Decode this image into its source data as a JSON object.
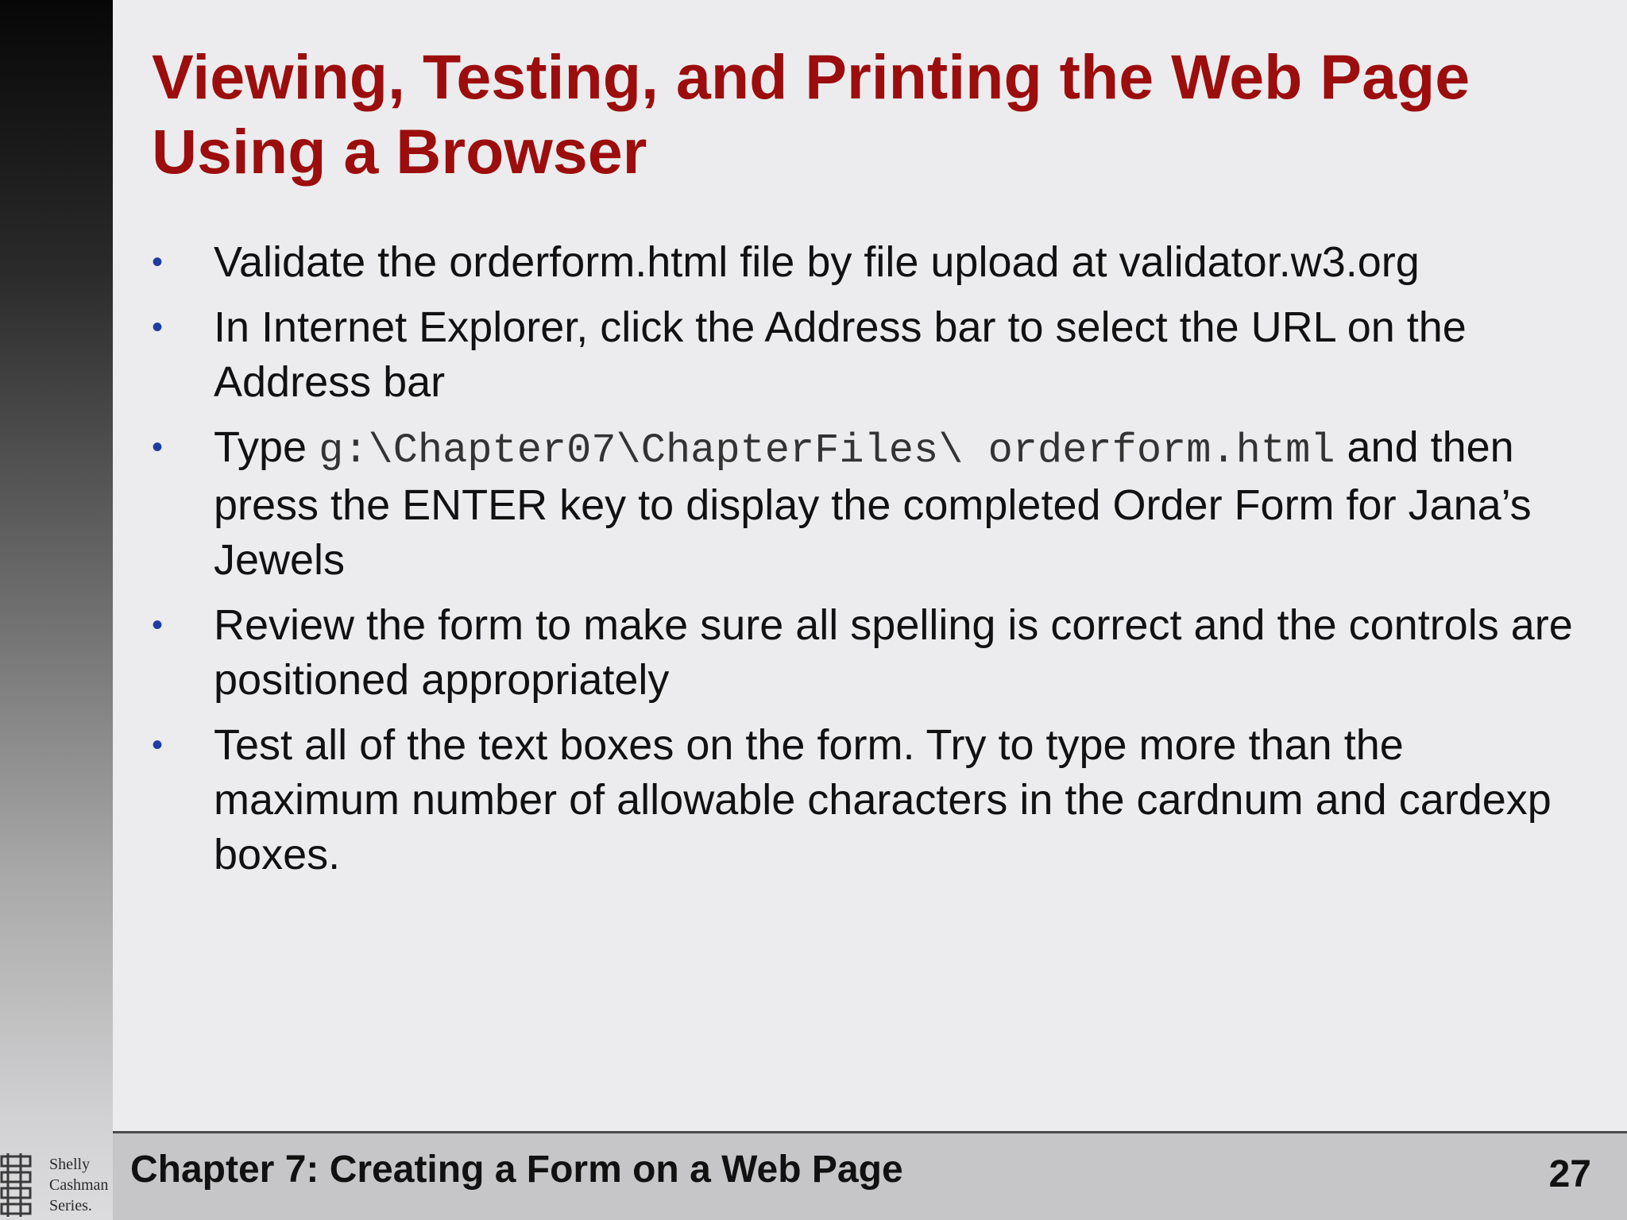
{
  "title": "Viewing, Testing, and Printing the Web Page Using a Browser",
  "bullets": [
    {
      "text": "Validate the orderform.html file by file upload at validator.w3.org"
    },
    {
      "text": "In Internet Explorer, click the Address bar to select the URL on the Address bar"
    },
    {
      "text_before": "Type ",
      "code": "g:\\Chapter07\\ChapterFiles\\ orderform.html",
      "text_after": " and then press the ENTER key to display the completed Order Form for Jana’s Jewels"
    },
    {
      "text": "Review the form to make sure all spelling is correct and the controls are positioned appropriately"
    },
    {
      "text": "Test all of the text boxes on the form. Try to type more than the maximum number of allowable characters in the cardnum and cardexp boxes."
    }
  ],
  "footer": {
    "chapter": "Chapter 7: Creating a Form on a Web Page",
    "page_number": "27"
  },
  "logo": {
    "icon": "shelly-cashman-series-logo-icon",
    "text_lines": [
      "Shelly",
      "Cashman",
      "Series."
    ]
  },
  "colors": {
    "title": "#9c0d0d",
    "bullet_marker": "#1f3d9e",
    "footer_bg": "#c6c6c8",
    "page_bg": "#ececee"
  }
}
